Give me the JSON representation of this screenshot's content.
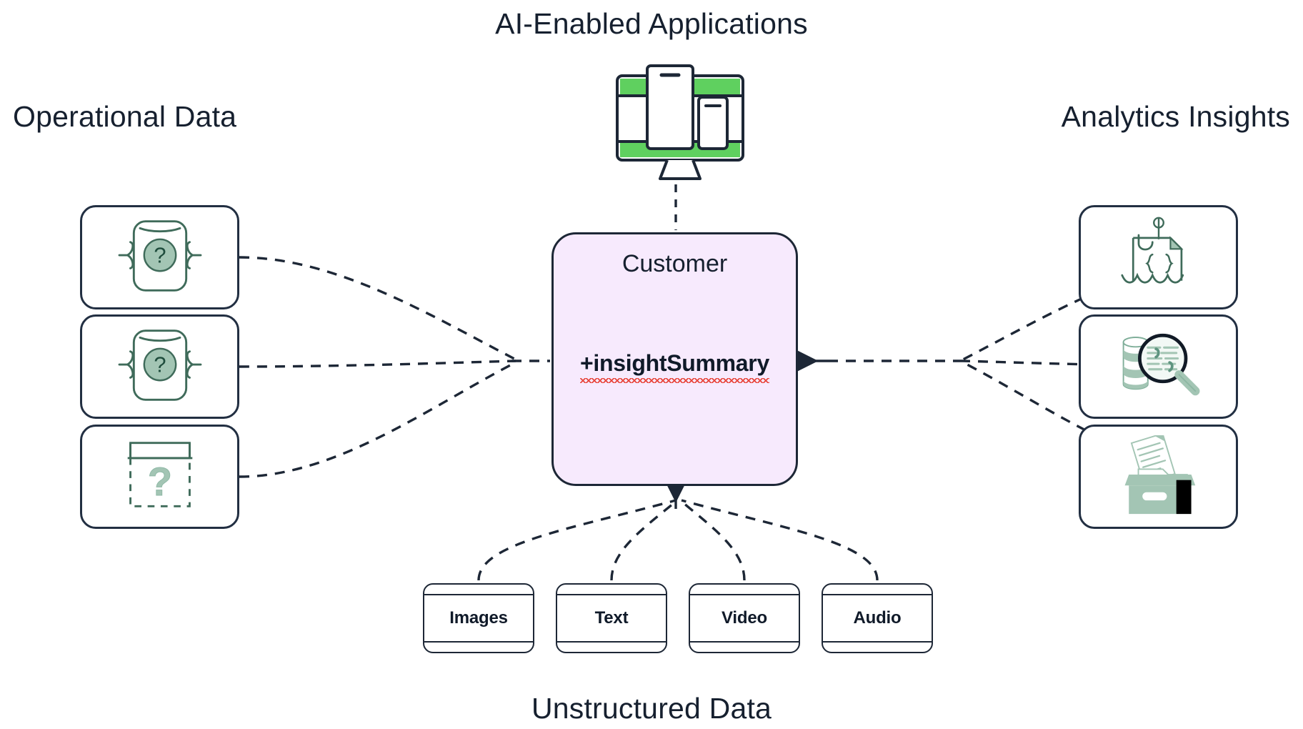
{
  "diagram": {
    "title_center_top": "AI-Enabled Applications",
    "title_left": "Operational Data",
    "title_right": "Analytics Insights",
    "title_bottom": "Unstructured Data",
    "background_color": "#ffffff",
    "text_color": "#16202f"
  },
  "center_entity": {
    "name": "Customer",
    "attribute": "+insightSummary",
    "fill_color": "#f7eafd",
    "border_color": "#1d2736",
    "spellcheck_underline_color": "#e8493f"
  },
  "operational_data": {
    "label": "Operational Data",
    "cards": [
      {
        "icon": "document-braces-question-icon",
        "alt": "document with curly braces and question mark"
      },
      {
        "icon": "document-braces-question-icon",
        "alt": "document with curly braces and question mark"
      },
      {
        "icon": "table-dashed-question-icon",
        "alt": "table with dashed body and question mark"
      }
    ]
  },
  "analytics_insights": {
    "label": "Analytics Insights",
    "cards": [
      {
        "icon": "json-fishing-hook-icon",
        "alt": "JSON document on a fishing hook over water"
      },
      {
        "icon": "database-magnifier-icon",
        "alt": "magnifying glass over database records"
      },
      {
        "icon": "file-archive-box-icon",
        "alt": "archive box with documents"
      }
    ]
  },
  "unstructured_data": {
    "label": "Unstructured Data",
    "nodes": [
      {
        "label": "Images"
      },
      {
        "label": "Text"
      },
      {
        "label": "Video"
      },
      {
        "label": "Audio"
      }
    ]
  },
  "ai_enabled_applications": {
    "label": "AI-Enabled Applications",
    "icon": "desktop-monitor-devices-icon",
    "accent_color": "#5fd05f"
  },
  "palette": {
    "ink": "#1d2736",
    "sage": "#a3c5b4",
    "sage_dark": "#3f6b5a",
    "green": "#5fd05f",
    "lavender": "#f7eafd",
    "red": "#e8493f"
  }
}
